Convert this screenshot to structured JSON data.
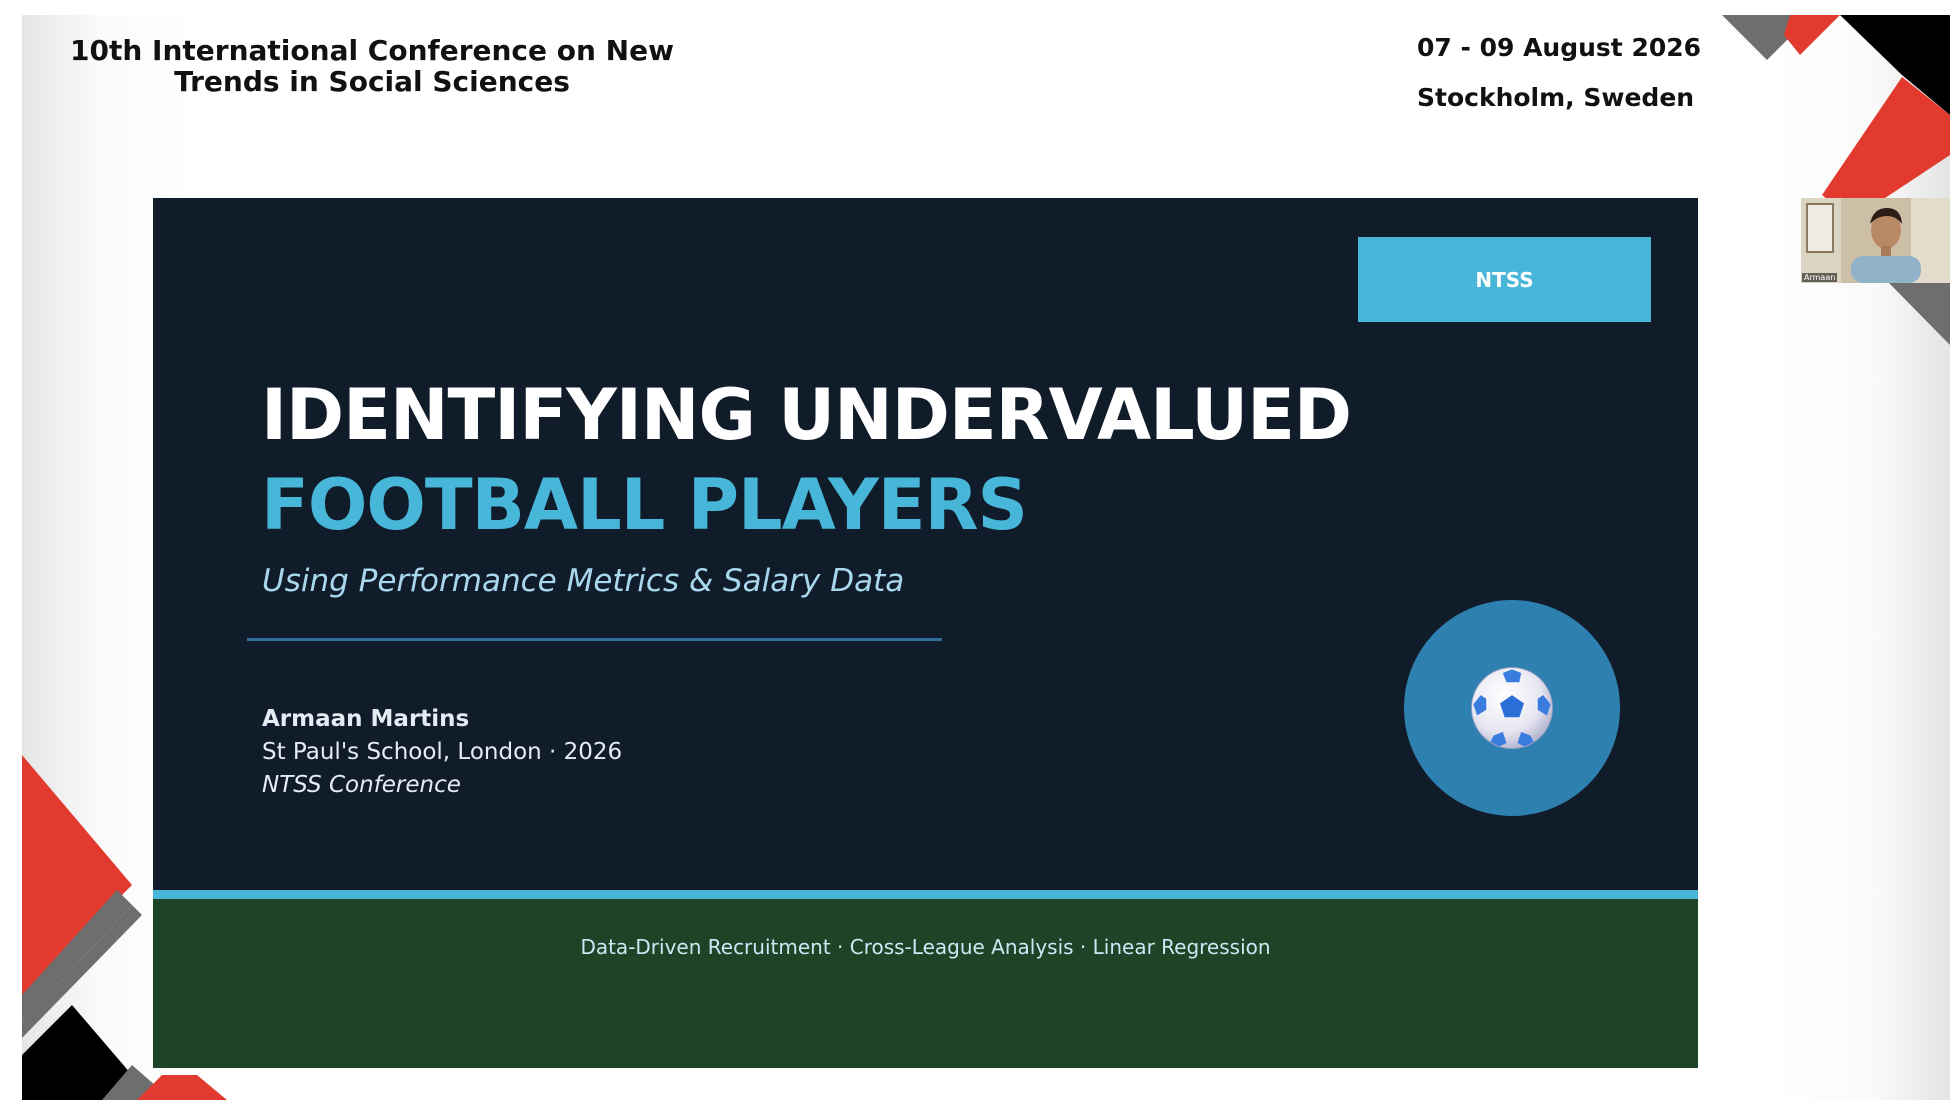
{
  "conference": {
    "title": "10th International Conference on New Trends in Social Sciences",
    "dates": "07 - 09 August 2026",
    "location": "Stockholm, Sweden"
  },
  "slide": {
    "badge": "NTSS",
    "title_line1": "IDENTIFYING UNDERVALUED",
    "title_line2": "FOOTBALL PLAYERS",
    "subtitle": "Using Performance Metrics & Salary Data",
    "author": "Armaan Martins",
    "school_line": "St Paul's School, London  ·  2026",
    "conference_name": "NTSS Conference",
    "keywords": "Data-Driven Recruitment  ·  Cross-League Analysis  ·  Linear Regression",
    "icon": "soccer-ball-icon"
  },
  "video": {
    "participant_name": "Armaan"
  },
  "colors": {
    "slide_bg": "#111c2b",
    "accent_blue": "#48b6d8",
    "footer_green": "#1e4427",
    "deco_red": "#e33a30",
    "deco_gray": "#6e6e6e",
    "deco_black": "#000000"
  }
}
